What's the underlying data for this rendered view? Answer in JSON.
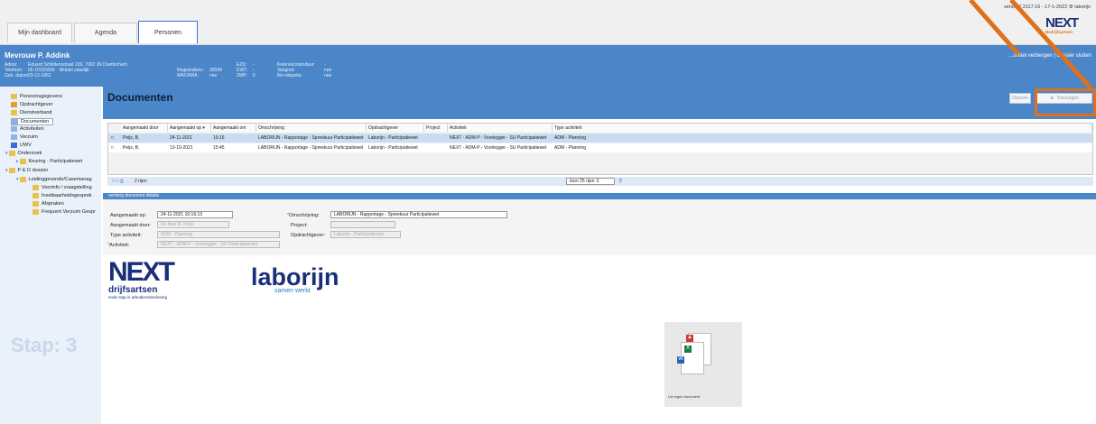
{
  "app": {
    "version": "versie 7.2117.16 - 17-1-2022",
    "user": "laborijn",
    "logo_main": "NEXT",
    "logo_sub": "Bedrijfsartsen"
  },
  "tabs": [
    {
      "label": "Mijn dashboard"
    },
    {
      "label": "Agenda"
    },
    {
      "label": "Personen"
    }
  ],
  "person": {
    "name": "Mevrouw P. Addink",
    "adres_label": "Adres:",
    "adres": "Eduard Schildersstraat 226, 7002 JN Doetinchem",
    "telefoon_label": "Telefoon:",
    "telefoon": "06-10101828",
    "mobiel_label": "Mobiel zakelijk:",
    "gebdatum_label": "Geb. datum:",
    "gebdatum": "23-12-1962",
    "registratienr_label": "Registratienr.:",
    "registratienr": "36594",
    "wao_label": "WAO/WIA:",
    "wao": "nee",
    "ezd_label": "EZD:",
    "ezd": "-",
    "ewt_label": "EWT:",
    "ewt": "-",
    "zmp_label": "ZMP:",
    "zmp": "0",
    "keten_label": "Ketenverzuimduur:",
    "keten": "-",
    "vangnet_label": "Vangnet:",
    "vangnet": "nee",
    "norisk_label": "No-riskpolis:",
    "norisk": "nee",
    "links": "...instel verbergen | dossier sluiten"
  },
  "sidebar": {
    "items": [
      {
        "label": "Persoonsgegevens"
      },
      {
        "label": "Opdrachtgever"
      },
      {
        "label": "Dienstverband"
      },
      {
        "label": "Documenten"
      },
      {
        "label": "Activiteiten"
      },
      {
        "label": "Verzuim"
      },
      {
        "label": "UWV"
      },
      {
        "label": "Onderzoek"
      },
      {
        "label": "Keuring - Participatiewet"
      },
      {
        "label": "P & O dossier"
      },
      {
        "label": "Leidinggevende/Casemanag"
      },
      {
        "label": "Voorinfo / vraagstelling"
      },
      {
        "label": "Inzetbaarheidsgesprek"
      },
      {
        "label": "Afspraken"
      },
      {
        "label": "Frequent Verzuim Gespr"
      }
    ],
    "stap": "Stap: 3"
  },
  "documents": {
    "title": "Documenten",
    "open_btn": "Openen",
    "add_btn": "Toevoegen",
    "columns": [
      "Aangemaakt door",
      "Aangemaakt op ▾",
      "Aangemaakt om",
      "Omschrijving",
      "Opdrachtgever",
      "Project",
      "Activiteit",
      "Type activiteit"
    ],
    "rows": [
      {
        "door": "Peijs, B.",
        "op": "24-11-2021",
        "om": "10:16",
        "omschrijving": "LABORIJN - Rapportage - Spreekuur Participatiewet",
        "opdrachtgever": "Laborijn - Participatiewet",
        "project": "",
        "activiteit": "NEXT - ADM-P - Voorlegger - SU Participatiewet",
        "type": "ADM - Planning"
      },
      {
        "door": "Peijs, B.",
        "op": "13-10-2021",
        "om": "15:45",
        "omschrijving": "LABORIJN - Rapportage - Spreekuur Participatiewet",
        "opdrachtgever": "Laborijn - Participatiewet",
        "project": "",
        "activiteit": "NEXT - ADM-P - Voorlegger - SU Participatiewet",
        "type": "ADM - Planning"
      }
    ],
    "rowcount": "2 rijen",
    "show_rows": "toon 25 rijen"
  },
  "details": {
    "header": "verberg document details",
    "aangemaakt_op_label": "Aangemaakt op:",
    "aangemaakt_op": "24-11-2021 10:16:13",
    "aangemaakt_door_label": "Aangemaakt door:",
    "aangemaakt_door": "De heer B. Peijs",
    "type_label": "Type activiteit:",
    "type": "ADM - Planning",
    "activiteit_label": "Activiteit:",
    "activiteit": "NEXT - ADM-P - Voorlegger - SU Participatiewet",
    "omschrijving_label": "Omschrijving:",
    "omschrijving": "LABORIJN - Rapportage - Spreekuur Participatiewet",
    "project_label": "Project:",
    "project": "",
    "opdrachtgever_label": "Opdrachtgever:",
    "opdrachtgever": "Laborijn - Participatiewet"
  },
  "preview": {
    "next_logo": "NEXT",
    "next_sub": "drijfsartsen",
    "next_tag": "ende stap in arbodienstverlening",
    "laborijn": "laborijn",
    "laborijn_sub": "samen werkt",
    "card_label": "Uw eigen document"
  },
  "colors": {
    "blue": "#4b86c8",
    "orange": "#e07019",
    "navy": "#1a2f7a"
  }
}
